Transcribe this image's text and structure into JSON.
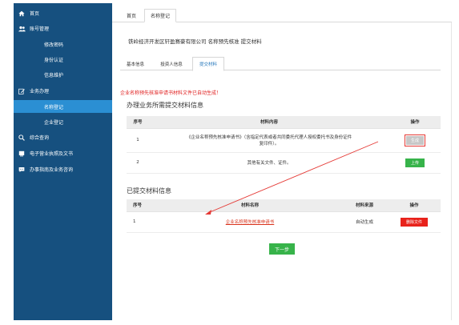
{
  "sidebar": {
    "items": [
      {
        "label": "首页",
        "icon": "home-icon"
      },
      {
        "label": "账号管理",
        "icon": "users-icon"
      },
      {
        "label": "修改密码"
      },
      {
        "label": "身份认证"
      },
      {
        "label": "信息维护"
      },
      {
        "label": "业务办理",
        "icon": "edit-icon"
      },
      {
        "label": "名称登记",
        "active": true
      },
      {
        "label": "企业登记"
      },
      {
        "label": "综合查询",
        "icon": "search-icon"
      },
      {
        "label": "电子营业执照及文书",
        "icon": "license-icon"
      },
      {
        "label": "办事指南及业务咨询",
        "icon": "chat-icon"
      }
    ]
  },
  "topbar": {
    "tabs": [
      {
        "label": "首页"
      },
      {
        "label": "名称登记",
        "active": true
      }
    ]
  },
  "page": {
    "heading": "铁岭经济开发区轩盈赛豪有限公司 名称预先核准 提交材料",
    "subtabs": [
      {
        "label": "基本信息"
      },
      {
        "label": "投资人信息"
      },
      {
        "label": "提交材料",
        "active": true
      }
    ],
    "notice": "企业名称预先核准申请书材料文件已自动生成！",
    "required_section_title": "办理业务所需提交材料信息",
    "required_table": {
      "headers": [
        "序号",
        "材料内容",
        "操作"
      ],
      "rows": [
        {
          "no": "1",
          "content_line1": "《企业名称预先核准申请书》（含指定代表或者共同委托代理人授权委托书及身份证件",
          "content_line2": "复印件）。",
          "action": "生成"
        },
        {
          "no": "2",
          "content_line1": "其他有关文件、证件。",
          "content_line2": "",
          "action": "上传"
        }
      ]
    },
    "submitted_section_title": "已提交材料信息",
    "submitted_table": {
      "headers": [
        "序号",
        "材料名称",
        "材料来源",
        "操作"
      ],
      "rows": [
        {
          "no": "1",
          "name": "企业名称预先核准申请书",
          "source": "自动生成",
          "action": "删除文件"
        }
      ]
    },
    "next_button": "下一步"
  },
  "colors": {
    "sidebar_bg": "#16507f",
    "sidebar_active": "#2b8fd3",
    "green": "#37b34a",
    "red": "#e8221b",
    "notice_red": "#e02020"
  }
}
